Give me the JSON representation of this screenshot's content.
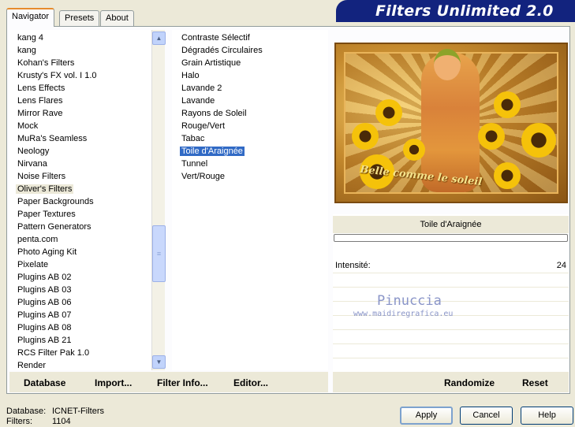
{
  "tabs": [
    "Navigator",
    "Presets",
    "About"
  ],
  "app_title": "Filters Unlimited 2.0",
  "categories": [
    "kang 4",
    "kang",
    "Kohan's Filters",
    "Krusty's FX vol. I 1.0",
    "Lens Effects",
    "Lens Flares",
    "Mirror Rave",
    "Mock",
    "MuRa's Seamless",
    "Neology",
    "Nirvana",
    "Noise Filters",
    "Oliver's Filters",
    "Paper Backgrounds",
    "Paper Textures",
    "Pattern Generators",
    "penta.com",
    "Photo Aging Kit",
    "Pixelate",
    "Plugins AB 02",
    "Plugins AB 03",
    "Plugins AB 06",
    "Plugins AB 07",
    "Plugins AB 08",
    "Plugins AB 21",
    "RCS Filter Pak 1.0",
    "Render"
  ],
  "selected_category": "Oliver's Filters",
  "filters": [
    "Contraste Sélectif",
    "Dégradés Circulaires",
    "Grain Artistique",
    "Halo",
    "Lavande 2",
    "Lavande",
    "Rayons de Soleil",
    "Rouge/Vert",
    "Tabac",
    "Toile d'Araignée",
    "Tunnel",
    "Vert/Rouge"
  ],
  "selected_filter": "Toile d'Araignée",
  "bottom_buttons": {
    "database": "Database",
    "import": "Import...",
    "filter_info": "Filter Info...",
    "editor": "Editor...",
    "randomize": "Randomize",
    "reset": "Reset"
  },
  "preview_text": "Belle comme le soleil",
  "current_filter_name": "Toile d'Araignée",
  "param": {
    "label": "Intensité:",
    "value": "24"
  },
  "watermark": {
    "name": "Pinuccia",
    "url": "www.maidiregrafica.eu"
  },
  "status": {
    "database_label": "Database:",
    "database_value": "ICNET-Filters",
    "filters_label": "Filters:",
    "filters_value": "1104"
  },
  "dialog_buttons": {
    "apply": "Apply",
    "cancel": "Cancel",
    "help": "Help"
  },
  "colors": {
    "selection": "#316ac5",
    "banner": "#12237e",
    "tab_accent": "#e68b2c"
  }
}
